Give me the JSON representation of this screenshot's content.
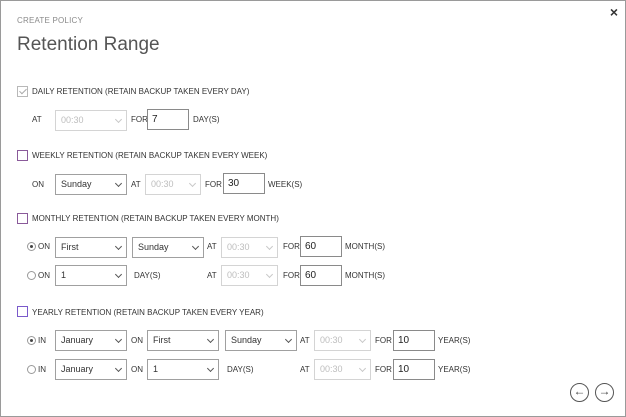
{
  "header": {
    "crumb": "CREATE POLICY",
    "title": "Retention Range",
    "close": "×"
  },
  "daily": {
    "label": "DAILY RETENTION (RETAIN BACKUP TAKEN EVERY DAY)",
    "checked": true,
    "at_label": "AT",
    "time": "00:30",
    "for_label": "FOR",
    "count": "7",
    "unit": "DAY(S)"
  },
  "weekly": {
    "label": "WEEKLY RETENTION (RETAIN BACKUP TAKEN EVERY WEEK)",
    "checked": false,
    "on_label": "ON",
    "day": "Sunday",
    "at_label": "AT",
    "time": "00:30",
    "for_label": "FOR",
    "count": "30",
    "unit": "WEEK(S)"
  },
  "monthly": {
    "label": "MONTHLY RETENTION (RETAIN BACKUP TAKEN EVERY MONTH)",
    "checked": false,
    "row1": {
      "radio_label": "ON",
      "selected": true,
      "week": "First",
      "day": "Sunday",
      "at_label": "AT",
      "time": "00:30",
      "for_label": "FOR",
      "count": "60",
      "unit": "MONTH(S)"
    },
    "row2": {
      "radio_label": "ON",
      "selected": false,
      "daynum": "1",
      "day_unit": "DAY(S)",
      "at_label": "AT",
      "time": "00:30",
      "for_label": "FOR",
      "count": "60",
      "unit": "MONTH(S)"
    }
  },
  "yearly": {
    "label": "YEARLY RETENTION (RETAIN BACKUP TAKEN EVERY YEAR)",
    "checked": false,
    "row1": {
      "radio_label": "IN",
      "selected": true,
      "month": "January",
      "on_label": "ON",
      "week": "First",
      "day": "Sunday",
      "at_label": "AT",
      "time": "00:30",
      "for_label": "FOR",
      "count": "10",
      "unit": "YEAR(S)"
    },
    "row2": {
      "radio_label": "IN",
      "selected": false,
      "month": "January",
      "on_label": "ON",
      "daynum": "1",
      "day_unit": "DAY(S)",
      "at_label": "AT",
      "time": "00:30",
      "for_label": "FOR",
      "count": "10",
      "unit": "YEAR(S)"
    }
  },
  "footer": {
    "back_icon": "arrow-left-icon",
    "next_icon": "arrow-right-icon",
    "back_glyph": "←",
    "next_glyph": "→"
  }
}
